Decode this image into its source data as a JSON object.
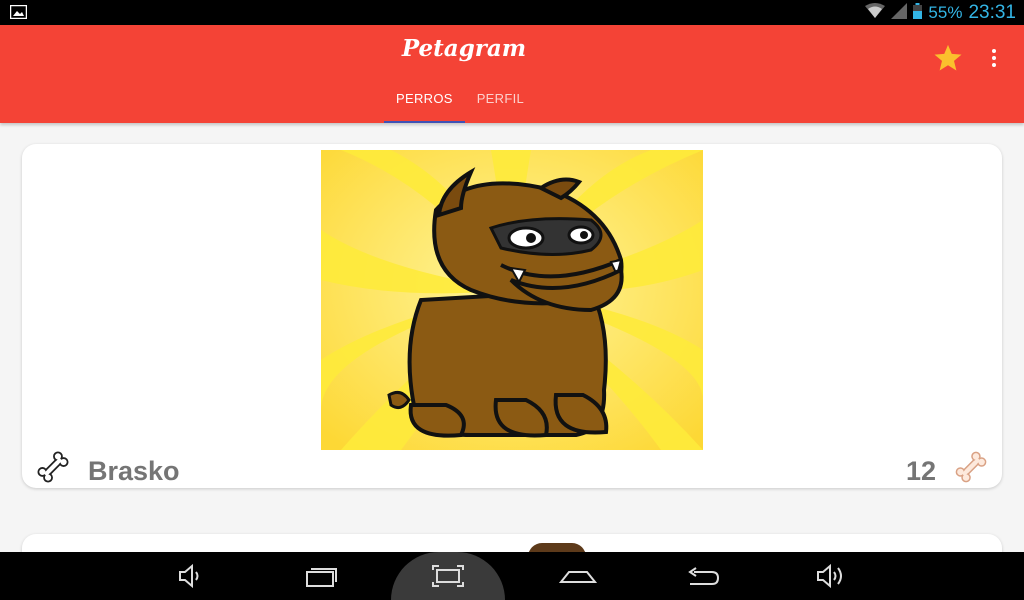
{
  "status_bar": {
    "battery_percent": "55%",
    "time": "23:31",
    "icons": [
      "image-notification-icon",
      "wifi-icon",
      "signal-icon",
      "battery-icon"
    ]
  },
  "app_bar": {
    "title": "Petagram",
    "actions": [
      "star-icon",
      "overflow-menu-icon"
    ],
    "tabs": [
      {
        "label": "PERROS",
        "active": true
      },
      {
        "label": "PERFIL",
        "active": false
      }
    ]
  },
  "cards": [
    {
      "name": "Brasko",
      "likes": "12",
      "image": "cartoon bulldog"
    }
  ],
  "nav_bar": {
    "buttons": [
      "volume-down-icon",
      "recent-apps-icon",
      "screenshot-icon",
      "home-icon",
      "back-icon",
      "volume-up-icon"
    ]
  },
  "colors": {
    "primary": "#f44336",
    "tab_indicator": "#3f51b5",
    "status_accent": "#33b5e5",
    "star": "#fbc02d"
  }
}
